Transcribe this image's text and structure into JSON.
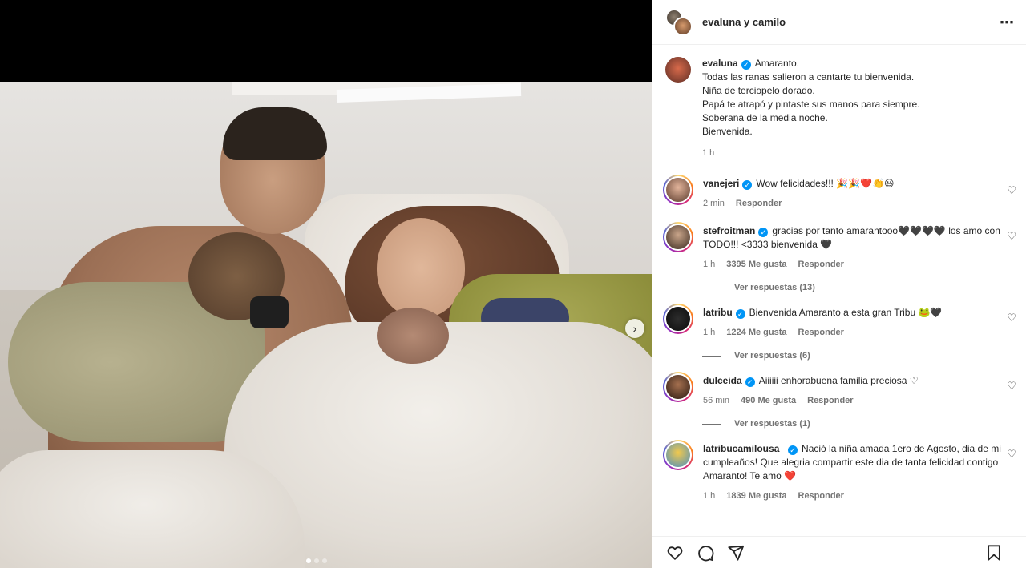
{
  "header": {
    "title": "evaluna y camilo"
  },
  "caption": {
    "user": "evaluna",
    "lines": [
      "Amaranto.",
      "Todas las ranas salieron a cantarte tu bienvenida.",
      "Niña de terciopelo dorado.",
      "Papá te atrapó y pintaste sus manos para siempre.",
      "Soberana de la media noche.",
      "Bienvenida."
    ],
    "time": "1 h"
  },
  "comments": [
    {
      "user": "vanejeri",
      "text": "Wow felicidades!!! 🎉🎉❤️👏😃",
      "time": "2 min",
      "likes": "",
      "reply": "Responder",
      "view_replies": ""
    },
    {
      "user": "stefroitman",
      "text": "gracias por tanto amarantooo🖤🖤🖤🖤 los amo con TODO!!! <3333 bienvenida 🖤",
      "time": "1 h",
      "likes": "3395 Me gusta",
      "reply": "Responder",
      "view_replies": "Ver respuestas (13)"
    },
    {
      "user": "latribu",
      "text": "Bienvenida Amaranto a esta gran Tribu 🐸🖤",
      "time": "1 h",
      "likes": "1224 Me gusta",
      "reply": "Responder",
      "view_replies": "Ver respuestas (6)"
    },
    {
      "user": "dulceida",
      "text": "Aiiiiii enhorabuena familia preciosa ♡",
      "time": "56 min",
      "likes": "490 Me gusta",
      "reply": "Responder",
      "view_replies": "Ver respuestas (1)"
    },
    {
      "user": "latribucamilousa_",
      "text": "Nació la niña amada 1ero de Agosto, dia de mi cumpleaños! Que alegria compartir este dia de tanta felicidad contigo Amaranto! Te amo ❤️",
      "time": "1 h",
      "likes": "1839 Me gusta",
      "reply": "Responder",
      "view_replies": ""
    }
  ],
  "icons": {
    "more": "⋯",
    "heart_small": "♡",
    "next": "›"
  },
  "colors": {
    "verified": "#0095f6",
    "muted": "#737373"
  }
}
